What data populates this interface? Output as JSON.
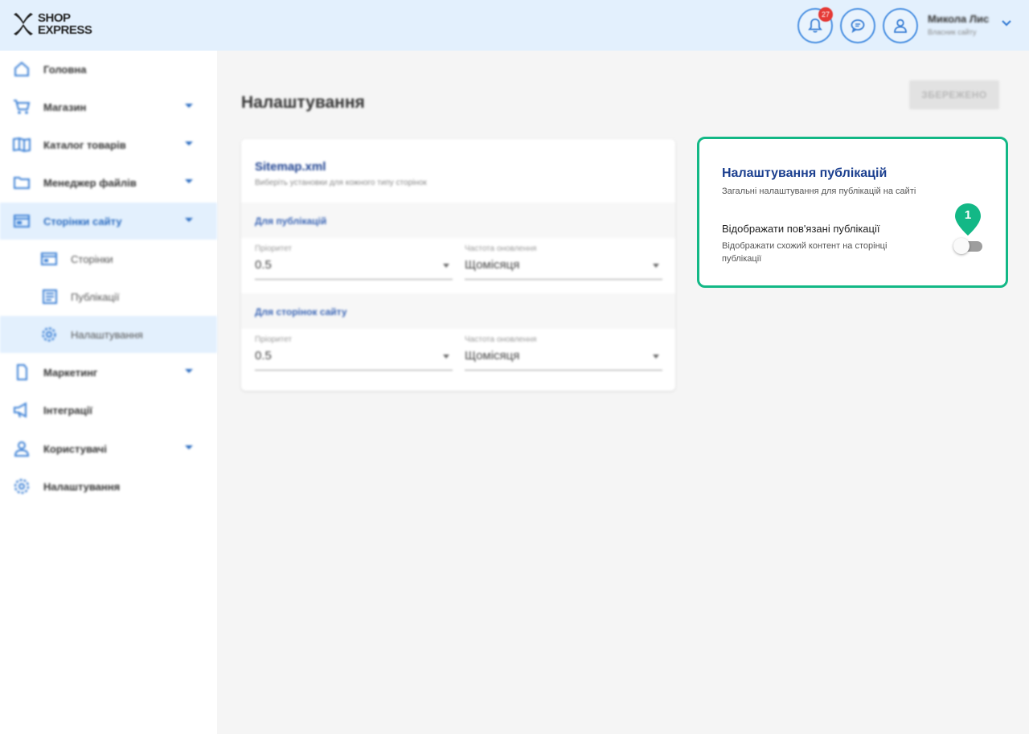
{
  "header": {
    "logo_line1": "SHOP",
    "logo_line2": "EXPRESS",
    "notifications_count": "27",
    "user_name": "Микола Лис",
    "user_role": "Власник сайту"
  },
  "sidebar": {
    "items": [
      {
        "label": "Головна",
        "icon": "home-icon"
      },
      {
        "label": "Магазин",
        "icon": "cart-icon"
      },
      {
        "label": "Каталог товарів",
        "icon": "catalog-icon"
      },
      {
        "label": "Менеджер файлів",
        "icon": "folder-icon"
      },
      {
        "label": "Сторінки сайту",
        "icon": "pages-icon"
      },
      {
        "label": "Сторінки",
        "icon": "page-icon"
      },
      {
        "label": "Публікації",
        "icon": "publication-icon"
      },
      {
        "label": "Налаштування",
        "icon": "gear-icon"
      },
      {
        "label": "Маркетинг",
        "icon": "marketing-icon"
      },
      {
        "label": "Інтеграції",
        "icon": "megaphone-icon"
      },
      {
        "label": "Користувачі",
        "icon": "user-icon"
      },
      {
        "label": "Налаштування",
        "icon": "gear-icon"
      }
    ]
  },
  "main": {
    "title": "Налаштування",
    "save_label": "ЗБЕРЕЖЕНО",
    "sitemap": {
      "title": "Sitemap.xml",
      "subtitle": "Виберіть установки для кожного типу сторінок",
      "sections": [
        {
          "label": "Для публікацій",
          "priority_label": "Пріоритет",
          "priority_value": "0.5",
          "frequency_label": "Частота оновлення",
          "frequency_value": "Щомісяця"
        },
        {
          "label": "Для сторінок сайту",
          "priority_label": "Пріоритет",
          "priority_value": "0.5",
          "frequency_label": "Частота оновлення",
          "frequency_value": "Щомісяця"
        }
      ]
    },
    "publications": {
      "title": "Налаштування публікацій",
      "subtitle": "Загальні налаштування для публікацій на сайті",
      "option_title": "Відображати пов'язані публікації",
      "option_desc": "Відображати схожий контент на сторінці публікації",
      "option_enabled": false,
      "marker": "1"
    }
  },
  "colors": {
    "accent": "#13b886",
    "brand_blue": "#1b3f8f",
    "header_bg": "#e3f0fd"
  }
}
